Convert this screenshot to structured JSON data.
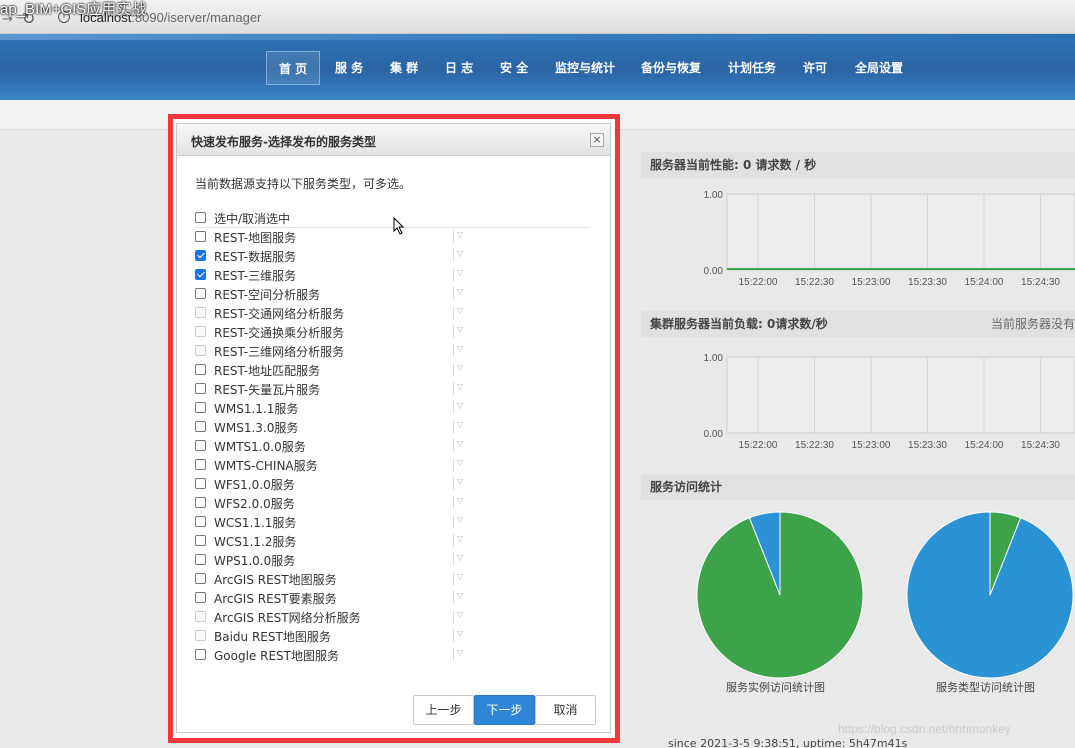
{
  "window": {
    "video_title": "ap_BIM+GIS应用实战",
    "url_host": "localhost",
    "url_rest": ":8090/iserver/manager"
  },
  "nav": {
    "items": [
      "首 页",
      "服 务",
      "集 群",
      "日 志",
      "安 全",
      "监控与统计",
      "备份与恢复",
      "计划任务",
      "许可",
      "全局设置"
    ],
    "active": "首 页"
  },
  "dialog": {
    "title": "快速发布服务-选择发布的服务类型",
    "close_glyph": "×",
    "intro": "当前数据源支持以下服务类型，可多选。",
    "select_all_label": "选中/取消选中",
    "options": [
      {
        "label": "REST-地图服务",
        "checked": false,
        "enabled": true
      },
      {
        "label": "REST-数据服务",
        "checked": true,
        "enabled": true
      },
      {
        "label": "REST-三维服务",
        "checked": true,
        "enabled": true
      },
      {
        "label": "REST-空间分析服务",
        "checked": false,
        "enabled": true
      },
      {
        "label": "REST-交通网络分析服务",
        "checked": false,
        "enabled": false
      },
      {
        "label": "REST-交通换乘分析服务",
        "checked": false,
        "enabled": false
      },
      {
        "label": "REST-三维网络分析服务",
        "checked": false,
        "enabled": false
      },
      {
        "label": "REST-地址匹配服务",
        "checked": false,
        "enabled": true
      },
      {
        "label": "REST-矢量瓦片服务",
        "checked": false,
        "enabled": true
      },
      {
        "label": "WMS1.1.1服务",
        "checked": false,
        "enabled": true
      },
      {
        "label": "WMS1.3.0服务",
        "checked": false,
        "enabled": true
      },
      {
        "label": "WMTS1.0.0服务",
        "checked": false,
        "enabled": true
      },
      {
        "label": "WMTS-CHINA服务",
        "checked": false,
        "enabled": true
      },
      {
        "label": "WFS1.0.0服务",
        "checked": false,
        "enabled": true
      },
      {
        "label": "WFS2.0.0服务",
        "checked": false,
        "enabled": true
      },
      {
        "label": "WCS1.1.1服务",
        "checked": false,
        "enabled": true
      },
      {
        "label": "WCS1.1.2服务",
        "checked": false,
        "enabled": true
      },
      {
        "label": "WPS1.0.0服务",
        "checked": false,
        "enabled": true
      },
      {
        "label": "ArcGIS REST地图服务",
        "checked": false,
        "enabled": true
      },
      {
        "label": "ArcGIS REST要素服务",
        "checked": false,
        "enabled": true
      },
      {
        "label": "ArcGIS REST网络分析服务",
        "checked": false,
        "enabled": false
      },
      {
        "label": "Baidu REST地图服务",
        "checked": false,
        "enabled": false
      },
      {
        "label": "Google REST地图服务",
        "checked": false,
        "enabled": true
      }
    ],
    "buttons": {
      "prev": "上一步",
      "next": "下一步",
      "cancel": "取消"
    }
  },
  "perf_panel": {
    "title": "服务器当前性能:  0 请求数 / 秒",
    "y_ticks": [
      "1.00",
      "0.00"
    ],
    "x_ticks": [
      "15:22:00",
      "15:22:30",
      "15:23:00",
      "15:23:30",
      "15:24:00",
      "15:24:30"
    ]
  },
  "cluster_panel": {
    "title": "集群服务器当前负载:  0请求数/秒",
    "right_note": "当前服务器没有",
    "y_ticks": [
      "1.00",
      "0.00"
    ],
    "x_ticks": [
      "15:22:00",
      "15:22:30",
      "15:23:00",
      "15:23:30",
      "15:24:00",
      "15:24:30"
    ]
  },
  "stats_panel": {
    "title": "服务访问统计",
    "since": "since 2021-3-5 9:38:51, uptime: 5h47m41s"
  },
  "chart_data": [
    {
      "type": "pie",
      "title": "服务实例访问统计图",
      "values": [
        94,
        6
      ],
      "colors": [
        "#3ca34a",
        "#2b93d4"
      ]
    },
    {
      "type": "pie",
      "title": "服务类型访问统计图",
      "values": [
        94,
        6
      ],
      "colors": [
        "#2b93d4",
        "#3ca34a"
      ]
    }
  ],
  "watermark": "https://blog.csdn.net/hhhmonkey"
}
